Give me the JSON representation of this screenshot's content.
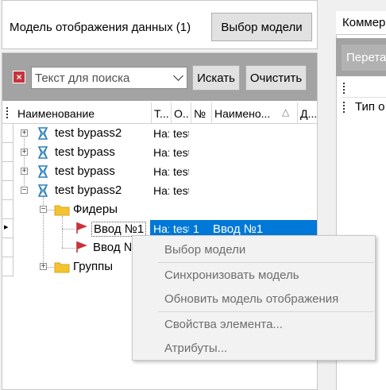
{
  "top_panel": {
    "model_label": "Модель отображения данных (1)",
    "select_model_button": "Выбор модели"
  },
  "search": {
    "placeholder": "Текст для поиска",
    "search_button": "Искать",
    "clear_button": "Очистить"
  },
  "grid": {
    "columns": [
      "Наименование",
      "Т...",
      "О...",
      "№",
      "Наимено...",
      "Д..."
    ],
    "rows": [
      {
        "name": "test bypass2",
        "t": "На:",
        "o": "test",
        "num": "",
        "name2": ""
      },
      {
        "name": "test bypass",
        "t": "На:",
        "o": "test",
        "num": "",
        "name2": ""
      },
      {
        "name": "test bypass",
        "t": "На:",
        "o": "test",
        "num": "",
        "name2": ""
      },
      {
        "name": "test bypass2",
        "t": "На:",
        "o": "test",
        "num": "",
        "name2": ""
      },
      {
        "name": "Фидеры",
        "t": "",
        "o": "",
        "num": "",
        "name2": ""
      },
      {
        "name": "Ввод №1",
        "t": "На:",
        "o": "test",
        "num": "1",
        "name2": "Ввод №1"
      },
      {
        "name": "Ввод №",
        "t": "",
        "o": "",
        "num": "",
        "name2": ""
      },
      {
        "name": "Группы",
        "t": "",
        "o": "",
        "num": "",
        "name2": ""
      }
    ]
  },
  "right_panel": {
    "tab_label": "Коммер",
    "button_label": "Перета",
    "row2_label": "Тип о"
  },
  "context_menu": {
    "items": [
      "Выбор модели",
      "Синхронизовать модель",
      "Обновить модель отображения",
      "Свойства элемента...",
      "Атрибуты..."
    ]
  },
  "colors": {
    "selection": "#0078d7",
    "toolbar_gray": "#a3a3a3",
    "feeder_flag": "#c8323c",
    "folder": "#f4c430"
  }
}
